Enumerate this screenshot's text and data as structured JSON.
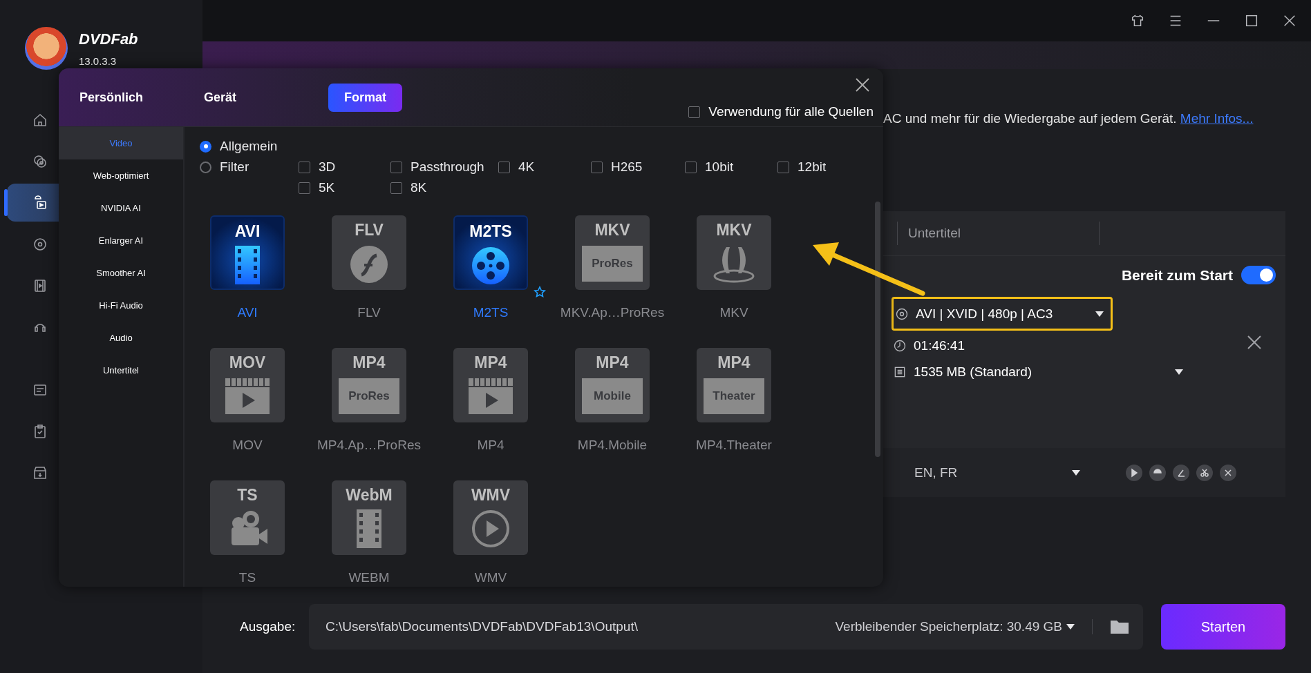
{
  "app": {
    "name": "DVDFab",
    "version": "13.0.3.3"
  },
  "sidebar": {
    "items": [
      {
        "kind": "home",
        "selected": false
      },
      {
        "kind": "copy",
        "selected": false
      },
      {
        "kind": "convert",
        "selected": true
      },
      {
        "kind": "disc",
        "selected": false
      },
      {
        "kind": "film",
        "selected": false
      },
      {
        "kind": "audio",
        "selected": false
      },
      {
        "kind": "queue",
        "selected": false
      },
      {
        "kind": "task",
        "selected": false
      },
      {
        "kind": "archive",
        "selected": false
      }
    ]
  },
  "description": {
    "text": "AC und mehr für die Wiedergabe auf jedem Gerät.",
    "link": "Mehr Infos..."
  },
  "task": {
    "tabs": [
      "Untertitel"
    ],
    "ready_label": "Bereit zum Start",
    "ready_on": true,
    "format": "AVI | XVID | 480p | AC3",
    "duration": "01:46:41",
    "size": "1535 MB (Standard)",
    "subtitles": "EN, FR"
  },
  "output": {
    "label": "Ausgabe:",
    "path": "C:\\Users\\fab\\Documents\\DVDFab\\DVDFab13\\Output\\",
    "free_space": "Verbleibender Speicherplatz: 30.49 GB",
    "start_button": "Starten"
  },
  "popup": {
    "tabs": [
      {
        "label": "Persönlich",
        "selected": false
      },
      {
        "label": "Gerät",
        "selected": false
      },
      {
        "label": "Format",
        "selected": true
      }
    ],
    "apply_all": {
      "label": "Verwendung für alle Quellen",
      "checked": false
    },
    "categories": [
      {
        "label": "Video",
        "selected": true
      },
      {
        "label": "Web-optimiert",
        "selected": false
      },
      {
        "label": "NVIDIA AI",
        "selected": false
      },
      {
        "label": "Enlarger AI",
        "selected": false
      },
      {
        "label": "Smoother AI",
        "selected": false
      },
      {
        "label": "Hi-Fi Audio",
        "selected": false
      },
      {
        "label": "Audio",
        "selected": false
      },
      {
        "label": "Untertitel",
        "selected": false
      }
    ],
    "modes": [
      {
        "label": "Allgemein",
        "selected": true
      },
      {
        "label": "Filter",
        "selected": false
      }
    ],
    "filters": [
      {
        "label": "3D",
        "checked": false
      },
      {
        "label": "Passthrough",
        "checked": false
      },
      {
        "label": "4K",
        "checked": false
      },
      {
        "label": "H265",
        "checked": false
      },
      {
        "label": "10bit",
        "checked": false
      },
      {
        "label": "12bit",
        "checked": false
      },
      {
        "label": "5K",
        "checked": false
      },
      {
        "label": "8K",
        "checked": false
      }
    ],
    "formats": [
      {
        "badge": "AVI",
        "kind": "film",
        "label": "AVI",
        "highlighted": true,
        "favorite": false
      },
      {
        "badge": "FLV",
        "kind": "flash",
        "label": "FLV",
        "highlighted": false,
        "favorite": false
      },
      {
        "badge": "M2TS",
        "kind": "reel",
        "label": "M2TS",
        "highlighted": true,
        "favorite": true
      },
      {
        "badge": "MKV",
        "kind": "box",
        "sub": "ProRes",
        "label": "MKV.Ap…ProRes",
        "highlighted": false,
        "favorite": false
      },
      {
        "badge": "MKV",
        "kind": "sound3d",
        "label": "MKV",
        "highlighted": false,
        "favorite": false
      },
      {
        "badge": "MOV",
        "kind": "clapper",
        "label": "MOV",
        "highlighted": false,
        "favorite": false
      },
      {
        "badge": "MP4",
        "kind": "box",
        "sub": "ProRes",
        "label": "MP4.Ap…ProRes",
        "highlighted": false,
        "favorite": false
      },
      {
        "badge": "MP4",
        "kind": "clapper",
        "label": "MP4",
        "highlighted": false,
        "favorite": false
      },
      {
        "badge": "MP4",
        "kind": "box",
        "sub": "Mobile",
        "label": "MP4.Mobile",
        "highlighted": false,
        "favorite": false
      },
      {
        "badge": "MP4",
        "kind": "box",
        "sub": "Theater",
        "label": "MP4.Theater",
        "highlighted": false,
        "favorite": false
      },
      {
        "badge": "TS",
        "kind": "camera",
        "label": "TS",
        "highlighted": false,
        "favorite": false
      },
      {
        "badge": "WebM",
        "kind": "film",
        "label": "WEBM",
        "highlighted": false,
        "favorite": false
      },
      {
        "badge": "WMV",
        "kind": "play",
        "label": "WMV",
        "highlighted": false,
        "favorite": false
      }
    ]
  }
}
